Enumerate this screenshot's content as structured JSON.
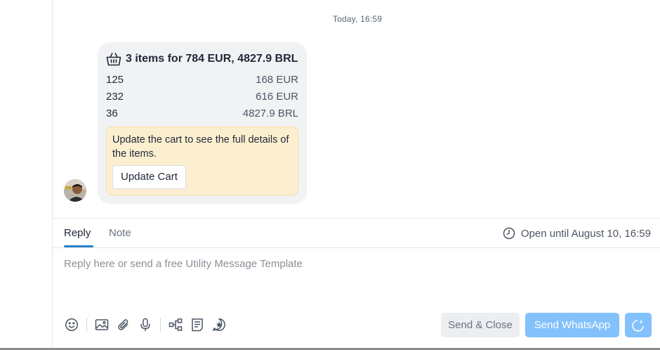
{
  "conversation": {
    "timestamp": "Today, 16:59"
  },
  "cart_message": {
    "icon": "basket-icon",
    "title": "3 items for 784 EUR, 4827.9 BRL",
    "items": [
      {
        "qty": "125",
        "price": "168 EUR"
      },
      {
        "qty": "232",
        "price": "616 EUR"
      },
      {
        "qty": "36",
        "price": "4827.9 BRL"
      }
    ],
    "notice": "Update the cart to see the full details of the items.",
    "update_button": "Update Cart"
  },
  "composer": {
    "tabs": [
      {
        "label": "Reply",
        "active": true
      },
      {
        "label": "Note",
        "active": false
      }
    ],
    "open_until": "Open until August 10, 16:59",
    "input_placeholder": "Reply here or send a free Utility Message Template",
    "toolbar_icons": [
      "emoji-icon",
      "image-icon",
      "attachment-icon",
      "microphone-icon",
      "flow-icon",
      "template-icon",
      "quick-reply-icon"
    ],
    "send_close_label": "Send & Close",
    "send_whatsapp_label": "Send WhatsApp",
    "ai_button_icon": "ai-assist-icon"
  },
  "colors": {
    "accent": "#2b7fc9",
    "primary_button": "#82c1fb",
    "notice_bg": "#fcefd0",
    "bubble_bg": "#f1f2f4"
  }
}
